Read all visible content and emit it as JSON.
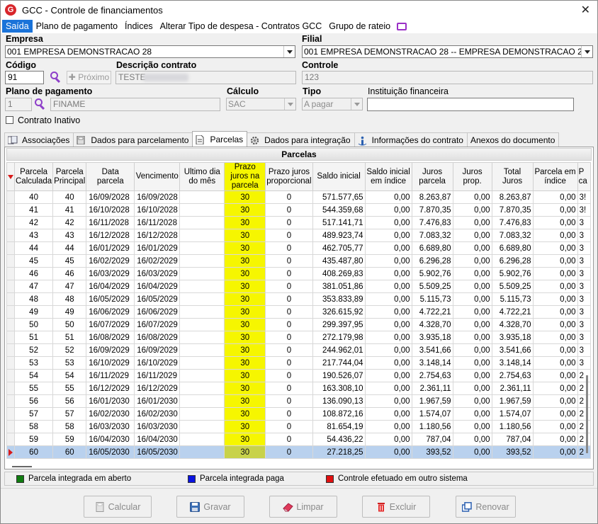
{
  "window": {
    "title": "GCC - Controle de financiamentos",
    "close": "✕"
  },
  "menu": [
    "Saída",
    "Plano de pagamento",
    "Índices",
    "Alterar Tipo de despesa - Contratos GCC",
    "Grupo de rateio"
  ],
  "form": {
    "empresa_label": "Empresa",
    "empresa_value": "001 EMPRESA DEMONSTRACAO 28",
    "filial_label": "Filial",
    "filial_value": "001 EMPRESA DEMONSTRACAO 28 -- EMPRESA DEMONSTRACAO 28",
    "codigo_label": "Código",
    "codigo_value": "91",
    "proximo_label": "Próximo",
    "descricao_label": "Descrição contrato",
    "descricao_value": "TESTE",
    "controle_label": "Controle",
    "controle_value": "123",
    "plano_label": "Plano de pagamento",
    "plano_code": "1",
    "plano_name": "FINAME",
    "calculo_label": "Cálculo",
    "calculo_value": "SAC",
    "tipo_label": "Tipo",
    "tipo_value": "A pagar",
    "instituicao_label": "Instituição financeira",
    "instituicao_value": "",
    "inativo_label": "Contrato Inativo"
  },
  "tabs": [
    {
      "label": "Associações",
      "icon": "associations-icon"
    },
    {
      "label": "Dados para parcelamento",
      "icon": "calculator-icon"
    },
    {
      "label": "Parcelas",
      "icon": "document-icon"
    },
    {
      "label": "Dados para integração",
      "icon": "gear-icon"
    },
    {
      "label": "Informações do contrato",
      "icon": "info-icon"
    },
    {
      "label": "Anexos do documento",
      "icon": ""
    }
  ],
  "grid": {
    "caption": "Parcelas",
    "columns": [
      "Parcela Calculada",
      "Parcela Principal",
      "Data parcela",
      "Vencimento",
      "Ultimo dia do mês",
      "Prazo juros na parcela",
      "Prazo juros proporcional",
      "Saldo inicial",
      "Saldo inicial em índice",
      "Juros parcela",
      "Juros prop.",
      "Total Juros",
      "Parcela em índice",
      "P ca"
    ],
    "rows": [
      [
        "40",
        "40",
        "16/09/2028",
        "16/09/2028",
        "",
        "30",
        "0",
        "571.577,65",
        "0,00",
        "8.263,87",
        "0,00",
        "8.263,87",
        "0,00",
        "3!"
      ],
      [
        "41",
        "41",
        "16/10/2028",
        "16/10/2028",
        "",
        "30",
        "0",
        "544.359,68",
        "0,00",
        "7.870,35",
        "0,00",
        "7.870,35",
        "0,00",
        "3!"
      ],
      [
        "42",
        "42",
        "16/11/2028",
        "16/11/2028",
        "",
        "30",
        "0",
        "517.141,71",
        "0,00",
        "7.476,83",
        "0,00",
        "7.476,83",
        "0,00",
        "3"
      ],
      [
        "43",
        "43",
        "16/12/2028",
        "16/12/2028",
        "",
        "30",
        "0",
        "489.923,74",
        "0,00",
        "7.083,32",
        "0,00",
        "7.083,32",
        "0,00",
        "3"
      ],
      [
        "44",
        "44",
        "16/01/2029",
        "16/01/2029",
        "",
        "30",
        "0",
        "462.705,77",
        "0,00",
        "6.689,80",
        "0,00",
        "6.689,80",
        "0,00",
        "3"
      ],
      [
        "45",
        "45",
        "16/02/2029",
        "16/02/2029",
        "",
        "30",
        "0",
        "435.487,80",
        "0,00",
        "6.296,28",
        "0,00",
        "6.296,28",
        "0,00",
        "3"
      ],
      [
        "46",
        "46",
        "16/03/2029",
        "16/03/2029",
        "",
        "30",
        "0",
        "408.269,83",
        "0,00",
        "5.902,76",
        "0,00",
        "5.902,76",
        "0,00",
        "3"
      ],
      [
        "47",
        "47",
        "16/04/2029",
        "16/04/2029",
        "",
        "30",
        "0",
        "381.051,86",
        "0,00",
        "5.509,25",
        "0,00",
        "5.509,25",
        "0,00",
        "3"
      ],
      [
        "48",
        "48",
        "16/05/2029",
        "16/05/2029",
        "",
        "30",
        "0",
        "353.833,89",
        "0,00",
        "5.115,73",
        "0,00",
        "5.115,73",
        "0,00",
        "3"
      ],
      [
        "49",
        "49",
        "16/06/2029",
        "16/06/2029",
        "",
        "30",
        "0",
        "326.615,92",
        "0,00",
        "4.722,21",
        "0,00",
        "4.722,21",
        "0,00",
        "3"
      ],
      [
        "50",
        "50",
        "16/07/2029",
        "16/07/2029",
        "",
        "30",
        "0",
        "299.397,95",
        "0,00",
        "4.328,70",
        "0,00",
        "4.328,70",
        "0,00",
        "3"
      ],
      [
        "51",
        "51",
        "16/08/2029",
        "16/08/2029",
        "",
        "30",
        "0",
        "272.179,98",
        "0,00",
        "3.935,18",
        "0,00",
        "3.935,18",
        "0,00",
        "3"
      ],
      [
        "52",
        "52",
        "16/09/2029",
        "16/09/2029",
        "",
        "30",
        "0",
        "244.962,01",
        "0,00",
        "3.541,66",
        "0,00",
        "3.541,66",
        "0,00",
        "3"
      ],
      [
        "53",
        "53",
        "16/10/2029",
        "16/10/2029",
        "",
        "30",
        "0",
        "217.744,04",
        "0,00",
        "3.148,14",
        "0,00",
        "3.148,14",
        "0,00",
        "3"
      ],
      [
        "54",
        "54",
        "16/11/2029",
        "16/11/2029",
        "",
        "30",
        "0",
        "190.526,07",
        "0,00",
        "2.754,63",
        "0,00",
        "2.754,63",
        "0,00",
        "2"
      ],
      [
        "55",
        "55",
        "16/12/2029",
        "16/12/2029",
        "",
        "30",
        "0",
        "163.308,10",
        "0,00",
        "2.361,11",
        "0,00",
        "2.361,11",
        "0,00",
        "2"
      ],
      [
        "56",
        "56",
        "16/01/2030",
        "16/01/2030",
        "",
        "30",
        "0",
        "136.090,13",
        "0,00",
        "1.967,59",
        "0,00",
        "1.967,59",
        "0,00",
        "2"
      ],
      [
        "57",
        "57",
        "16/02/2030",
        "16/02/2030",
        "",
        "30",
        "0",
        "108.872,16",
        "0,00",
        "1.574,07",
        "0,00",
        "1.574,07",
        "0,00",
        "2"
      ],
      [
        "58",
        "58",
        "16/03/2030",
        "16/03/2030",
        "",
        "30",
        "0",
        "81.654,19",
        "0,00",
        "1.180,56",
        "0,00",
        "1.180,56",
        "0,00",
        "2"
      ],
      [
        "59",
        "59",
        "16/04/2030",
        "16/04/2030",
        "",
        "30",
        "0",
        "54.436,22",
        "0,00",
        "787,04",
        "0,00",
        "787,04",
        "0,00",
        "2"
      ],
      [
        "60",
        "60",
        "16/05/2030",
        "16/05/2030",
        "",
        "30",
        "0",
        "27.218,25",
        "0,00",
        "393,52",
        "0,00",
        "393,52",
        "0,00",
        "2"
      ]
    ],
    "selected_row": 20
  },
  "legend": [
    {
      "label": "Parcela integrada em aberto",
      "color": "#107c10"
    },
    {
      "label": "Parcela integrada paga",
      "color": "#0a14e0"
    },
    {
      "label": "Controle efetuado em outro sistema",
      "color": "#e01010"
    }
  ],
  "buttons": [
    {
      "label": "Calcular",
      "icon": "calculator-icon"
    },
    {
      "label": "Gravar",
      "icon": "save-icon"
    },
    {
      "label": "Limpar",
      "icon": "eraser-icon"
    },
    {
      "label": "Excluir",
      "icon": "trash-icon"
    },
    {
      "label": "Renovar",
      "icon": "renew-icon"
    }
  ],
  "colors": {
    "accent": "#1a73d9",
    "highlight_column": "#f6f600",
    "selected_row": "#b9d1ee",
    "search_icon": "#8e3fc9"
  }
}
